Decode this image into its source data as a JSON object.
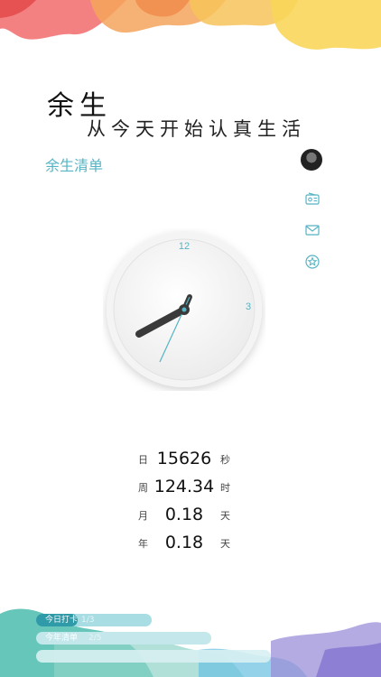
{
  "header": {
    "title": "余生",
    "subtitle": "从今天开始认真生活",
    "list_title": "余生清单"
  },
  "sidebar": {
    "avatar": "avatar",
    "icons": [
      "radio-icon",
      "mail-icon",
      "star-badge-icon"
    ]
  },
  "clock": {
    "label_12": "12",
    "label_3": "3",
    "hour_hand": "hour-hand",
    "minute_hand": "minute-hand",
    "second_hand": "second-hand"
  },
  "stats": [
    {
      "label": "日",
      "value": "15626",
      "unit": "秒"
    },
    {
      "label": "周",
      "value": "124.34",
      "unit": "时"
    },
    {
      "label": "月",
      "value": "0.18",
      "unit": "天"
    },
    {
      "label": "年",
      "value": "0.18",
      "unit": "天"
    }
  ],
  "bottom": {
    "checkin_label": "今日打卡",
    "checkin_count": "1/3",
    "list_label": "今年清单",
    "list_count": "2/5"
  },
  "colors": {
    "accent": "#56b4c4",
    "checkin_bar": "#6fc3cc",
    "list_bar": "#a8dde3"
  }
}
